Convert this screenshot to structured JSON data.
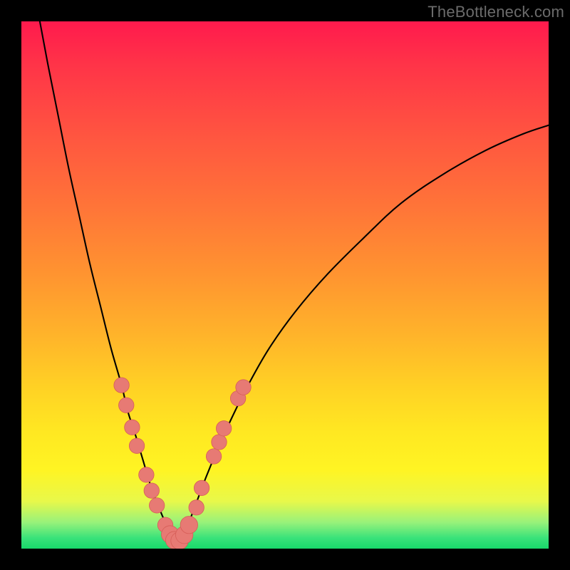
{
  "watermark": {
    "text": "TheBottleneck.com"
  },
  "colors": {
    "curve": "#000000",
    "dot_fill": "#e77a74",
    "dot_stroke": "#d65e58",
    "gradient_top": "#ff1a4d",
    "gradient_bottom": "#18d96a"
  },
  "chart_data": {
    "type": "line",
    "title": "",
    "xlabel": "",
    "ylabel": "",
    "xlim": [
      0,
      100
    ],
    "ylim": [
      0,
      100
    ],
    "grid": false,
    "legend": false,
    "annotations": [],
    "series": [
      {
        "name": "left-branch",
        "x": [
          3.5,
          5,
          7,
          9,
          11,
          13,
          15,
          17,
          19,
          20.2,
          21.5,
          23,
          24.5,
          26,
          27.5,
          28.5,
          29.5
        ],
        "values": [
          100,
          92,
          82,
          72,
          63,
          54,
          46,
          38,
          31,
          26,
          22,
          17,
          12,
          8,
          4.5,
          2.5,
          1.2
        ]
      },
      {
        "name": "right-branch",
        "x": [
          29.5,
          30.5,
          31.5,
          33,
          35,
          37.5,
          40,
          43,
          47,
          52,
          58,
          65,
          72,
          80,
          88,
          95,
          100
        ],
        "values": [
          1.2,
          2.2,
          4.3,
          8.2,
          13.5,
          19.5,
          25,
          31,
          38,
          45,
          52,
          59,
          65.5,
          71,
          75.5,
          78.6,
          80.3
        ]
      }
    ],
    "dots": [
      {
        "x": 19.0,
        "y": 31.0,
        "r": 1.45
      },
      {
        "x": 19.9,
        "y": 27.2,
        "r": 1.45
      },
      {
        "x": 21.0,
        "y": 23.0,
        "r": 1.45
      },
      {
        "x": 21.9,
        "y": 19.5,
        "r": 1.45
      },
      {
        "x": 23.7,
        "y": 14.0,
        "r": 1.45
      },
      {
        "x": 24.7,
        "y": 11.0,
        "r": 1.45
      },
      {
        "x": 25.7,
        "y": 8.2,
        "r": 1.45
      },
      {
        "x": 27.3,
        "y": 4.5,
        "r": 1.45
      },
      {
        "x": 28.2,
        "y": 2.7,
        "r": 1.65
      },
      {
        "x": 29.0,
        "y": 1.6,
        "r": 1.65
      },
      {
        "x": 30.0,
        "y": 1.5,
        "r": 1.65
      },
      {
        "x": 30.9,
        "y": 2.6,
        "r": 1.65
      },
      {
        "x": 31.8,
        "y": 4.5,
        "r": 1.65
      },
      {
        "x": 33.2,
        "y": 7.8,
        "r": 1.45
      },
      {
        "x": 34.2,
        "y": 11.5,
        "r": 1.45
      },
      {
        "x": 36.5,
        "y": 17.5,
        "r": 1.45
      },
      {
        "x": 37.5,
        "y": 20.2,
        "r": 1.45
      },
      {
        "x": 38.4,
        "y": 22.8,
        "r": 1.45
      },
      {
        "x": 41.1,
        "y": 28.5,
        "r": 1.45
      },
      {
        "x": 42.1,
        "y": 30.6,
        "r": 1.45
      }
    ]
  }
}
